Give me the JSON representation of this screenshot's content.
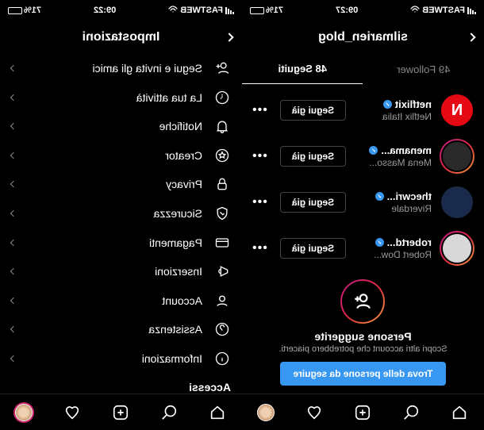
{
  "status": {
    "carrier": "FASTWEB",
    "battery_pct_left": "71%",
    "battery_pct_right": "71%",
    "time_left": "09:27",
    "time_right": "09:22"
  },
  "following_screen": {
    "title": "silmarien_blog",
    "tabs": {
      "followers_label": "49 Follower",
      "following_label": "48 Seguiti"
    },
    "users": [
      {
        "username": "netflixit",
        "display_name": "Netflix Italia",
        "button": "Segui già",
        "avatar_letter": "N",
        "avatar_bg": "#e50914",
        "has_ring": false
      },
      {
        "username": "menama...",
        "display_name": "Mena Masso...",
        "button": "Segui già",
        "avatar_letter": "",
        "avatar_bg": "#2a2a2a",
        "has_ring": true
      },
      {
        "username": "thecwri...",
        "display_name": "Riverdale",
        "button": "Segui già",
        "avatar_letter": "",
        "avatar_bg": "#1a2a4a",
        "has_ring": false
      },
      {
        "username": "robertd...",
        "display_name": "Robert Dow...",
        "button": "Segui già",
        "avatar_letter": "",
        "avatar_bg": "#d8d8d8",
        "has_ring": true
      }
    ],
    "suggest": {
      "title": "Persone suggerite",
      "subtitle": "Scopri altri account che potrebbero piacerti.",
      "button": "Trova delle persone da seguire"
    }
  },
  "settings_screen": {
    "title": "Impostazioni",
    "items": [
      {
        "label": "Segui e invita gli amici",
        "icon": "person-add"
      },
      {
        "label": "La tua attività",
        "icon": "clock"
      },
      {
        "label": "Notifiche",
        "icon": "bell"
      },
      {
        "label": "Creator",
        "icon": "star-badge"
      },
      {
        "label": "Privacy",
        "icon": "lock"
      },
      {
        "label": "Sicurezza",
        "icon": "shield"
      },
      {
        "label": "Pagamenti",
        "icon": "card"
      },
      {
        "label": "Inserzioni",
        "icon": "megaphone"
      },
      {
        "label": "Account",
        "icon": "user"
      },
      {
        "label": "Assistenza",
        "icon": "help"
      },
      {
        "label": "Informazioni",
        "icon": "info"
      }
    ],
    "section_header": "Accessi"
  }
}
